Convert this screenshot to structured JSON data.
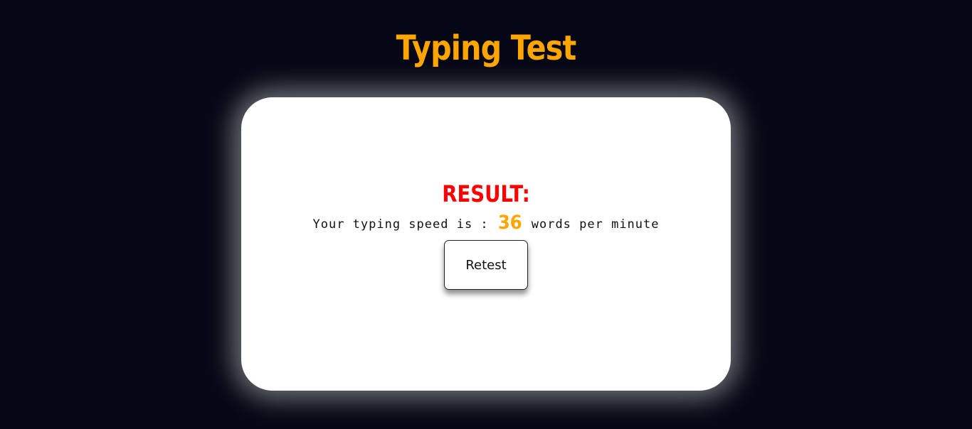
{
  "header": {
    "title": "Typing Test"
  },
  "result": {
    "heading": "RESULT:",
    "speed_prefix": "Your typing speed is :",
    "speed_value": "36",
    "speed_suffix": "words per minute"
  },
  "actions": {
    "retest_label": "Retest"
  },
  "colors": {
    "background": "#050814",
    "title": "#FFA500",
    "heading": "#FF0000",
    "speed_value": "#FFA500",
    "card": "#FFFFFF"
  }
}
